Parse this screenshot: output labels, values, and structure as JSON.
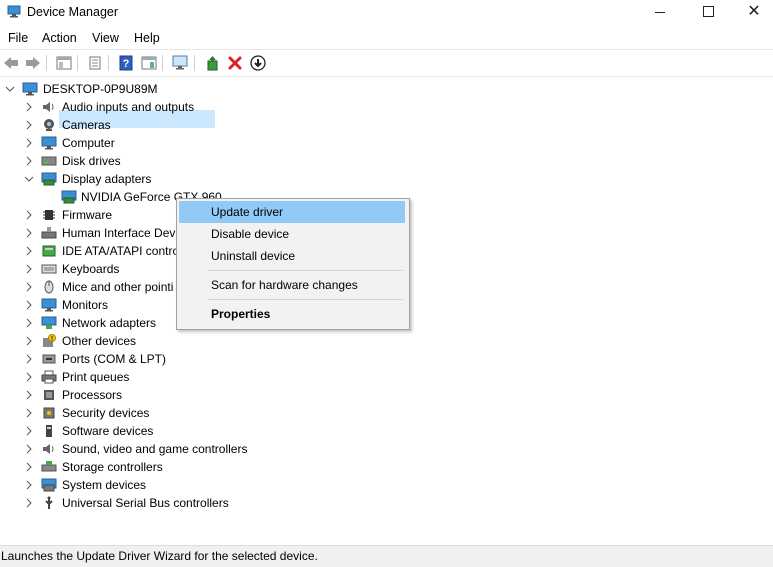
{
  "window": {
    "title": "Device Manager",
    "minimize_glyph": "",
    "maximize_glyph": "",
    "close_glyph": "✕"
  },
  "menu": [
    "File",
    "Action",
    "View",
    "Help"
  ],
  "toolbar": {
    "buttons": [
      "back-arrow-icon",
      "forward-arrow-icon",
      "show-hide-console-tree-icon",
      "properties-icon",
      "help-icon",
      "action-pane-icon",
      "scan-hardware-icon",
      "update-driver-icon",
      "uninstall-icon",
      "disable-icon"
    ],
    "accent_red": "#d92323",
    "accent_blue": "#2a6ad7"
  },
  "tree": {
    "root": "DESKTOP-0P9U89M",
    "categories": [
      {
        "label": "Audio inputs and outputs",
        "icon": "speaker-icon",
        "expanded": false
      },
      {
        "label": "Cameras",
        "icon": "camera-icon",
        "expanded": false
      },
      {
        "label": "Computer",
        "icon": "computer-icon",
        "expanded": false
      },
      {
        "label": "Disk drives",
        "icon": "disk-drive-icon",
        "expanded": false
      },
      {
        "label": "Display adapters",
        "icon": "display-adapter-icon",
        "expanded": true
      },
      {
        "label": "NVIDIA GeForce GTX 960",
        "icon": "display-adapter-icon",
        "child": true
      },
      {
        "label": "Firmware",
        "icon": "chip-icon",
        "expanded": false
      },
      {
        "label": "Human Interface Devi",
        "icon": "hid-icon",
        "expanded": false
      },
      {
        "label": "IDE ATA/ATAPI contro",
        "icon": "ide-controller-icon",
        "expanded": false
      },
      {
        "label": "Keyboards",
        "icon": "keyboard-icon",
        "expanded": false
      },
      {
        "label": "Mice and other pointi",
        "icon": "mouse-icon",
        "expanded": false
      },
      {
        "label": "Monitors",
        "icon": "monitor-icon",
        "expanded": false
      },
      {
        "label": "Network adapters",
        "icon": "network-adapter-icon",
        "expanded": false
      },
      {
        "label": "Other devices",
        "icon": "unknown-device-icon",
        "expanded": false
      },
      {
        "label": "Ports (COM & LPT)",
        "icon": "port-icon",
        "expanded": false
      },
      {
        "label": "Print queues",
        "icon": "printer-icon",
        "expanded": false
      },
      {
        "label": "Processors",
        "icon": "processor-icon",
        "expanded": false
      },
      {
        "label": "Security devices",
        "icon": "security-device-icon",
        "expanded": false
      },
      {
        "label": "Software devices",
        "icon": "software-device-icon",
        "expanded": false
      },
      {
        "label": "Sound, video and game controllers",
        "icon": "sound-controller-icon",
        "expanded": false
      },
      {
        "label": "Storage controllers",
        "icon": "storage-controller-icon",
        "expanded": false
      },
      {
        "label": "System devices",
        "icon": "system-device-icon",
        "expanded": false
      },
      {
        "label": "Universal Serial Bus controllers",
        "icon": "usb-icon",
        "expanded": false
      }
    ]
  },
  "context_menu": {
    "update_driver": "Update driver",
    "disable_device": "Disable device",
    "uninstall_device": "Uninstall device",
    "scan_hardware": "Scan for hardware changes",
    "properties": "Properties"
  },
  "status": "Launches the Update Driver Wizard for the selected device."
}
